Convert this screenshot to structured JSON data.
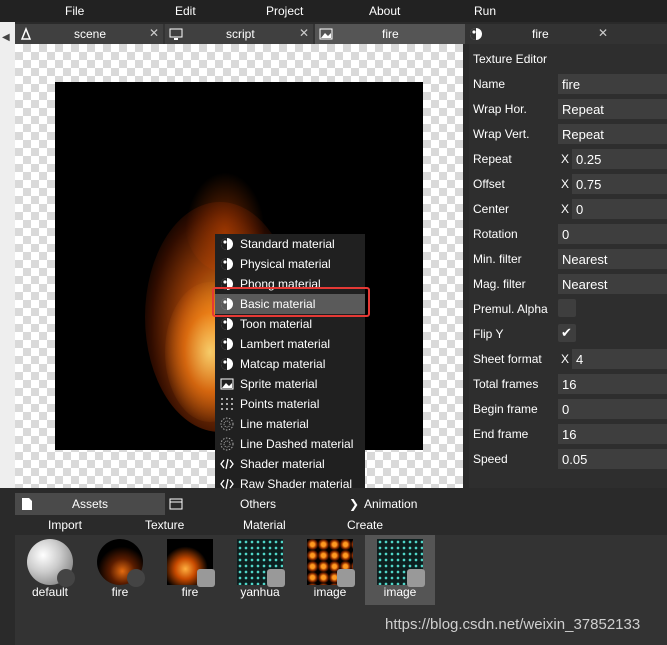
{
  "menubar": [
    "File",
    "Edit",
    "Project",
    "About",
    "Run"
  ],
  "tabs": [
    {
      "label": "scene",
      "icon": "scene-icon",
      "close": "✕"
    },
    {
      "label": "script",
      "icon": "monitor-icon",
      "close": "✕"
    },
    {
      "label": "fire",
      "icon": "image-icon",
      "close": ""
    },
    {
      "label": "fire",
      "icon": "material-icon",
      "close": "✕"
    }
  ],
  "context_menu": {
    "items": [
      {
        "label": "Standard material",
        "icon": "material-icon"
      },
      {
        "label": "Physical material",
        "icon": "material-icon"
      },
      {
        "label": "Phong material",
        "icon": "material-icon"
      },
      {
        "label": "Basic material",
        "icon": "material-icon"
      },
      {
        "label": "Toon material",
        "icon": "material-icon"
      },
      {
        "label": "Lambert material",
        "icon": "material-icon"
      },
      {
        "label": "Matcap material",
        "icon": "material-icon"
      },
      {
        "label": "Sprite material",
        "icon": "image-icon"
      },
      {
        "label": "Points material",
        "icon": "grid-icon"
      },
      {
        "label": "Line material",
        "icon": "dotted-sphere-icon"
      },
      {
        "label": "Line Dashed material",
        "icon": "dotted-sphere-icon"
      },
      {
        "label": "Shader material",
        "icon": "code-icon"
      },
      {
        "label": "Raw Shader material",
        "icon": "code-icon"
      }
    ],
    "highlighted": "Basic material"
  },
  "texture_editor": {
    "title": "Texture Editor",
    "fields": [
      {
        "label": "Name",
        "value": "fire"
      },
      {
        "label": "Wrap Hor.",
        "value": "Repeat"
      },
      {
        "label": "Wrap Vert.",
        "value": "Repeat"
      },
      {
        "label": "Repeat",
        "prefix": "X",
        "value": "0.25"
      },
      {
        "label": "Offset",
        "prefix": "X",
        "value": "0.75"
      },
      {
        "label": "Center",
        "prefix": "X",
        "value": "0"
      },
      {
        "label": "Rotation",
        "value": "0"
      },
      {
        "label": "Min. filter",
        "value": "Nearest"
      },
      {
        "label": "Mag. filter",
        "value": "Nearest"
      },
      {
        "label": "Premul. Alpha",
        "checkbox": false
      },
      {
        "label": "Flip Y",
        "checkbox": true
      },
      {
        "label": "Sheet format",
        "prefix": "X",
        "value": "4"
      },
      {
        "label": "Total frames",
        "value": "16"
      },
      {
        "label": "Begin frame",
        "value": "0"
      },
      {
        "label": "End frame",
        "value": "16"
      },
      {
        "label": "Speed",
        "value": "0.05"
      }
    ]
  },
  "assets": {
    "tabs": [
      "Assets",
      "Others",
      "Animation"
    ],
    "toolbar": [
      "Import",
      "Texture",
      "Material",
      "Create"
    ],
    "items": [
      {
        "name": "default",
        "kind": "sphere"
      },
      {
        "name": "fire",
        "kind": "fire-sphere"
      },
      {
        "name": "fire",
        "kind": "fire-texture"
      },
      {
        "name": "yanhua",
        "kind": "dots"
      },
      {
        "name": "image",
        "kind": "fire-grid"
      },
      {
        "name": "image",
        "kind": "dots",
        "selected": true
      }
    ]
  },
  "watermark": "https://blog.csdn.net/weixin_37852133",
  "colors": {
    "highlight_box": "#e53935",
    "panel": "#2e2e2e",
    "field": "#3e3e3e"
  }
}
